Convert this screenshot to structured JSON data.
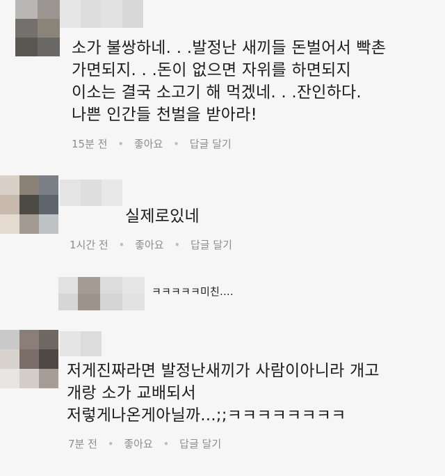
{
  "comments": [
    {
      "lines": [
        "소가 불쌍하네. . .발정난 새끼들 돈벌어서 빡촌",
        "가면되지. . .돈이 없으면 자위를 하면되지",
        "이소는 결국 소고기 해 먹겠네. . .잔인하다.",
        "나쁜 인간들 천벌을 받아라!"
      ],
      "time": "15분 전",
      "like_label": "좋아요",
      "reply_label": "답글 달기"
    },
    {
      "lines": [
        "실제로있네"
      ],
      "time": "1시간 전",
      "like_label": "좋아요",
      "reply_label": "답글 달기"
    },
    {
      "lines": [
        "ㅋㅋㅋㅋㅋ미친...."
      ]
    },
    {
      "lines": [
        "저게진짜라면 발정난새끼가 사람이아니라 개고",
        "개랑 소가 교배되서",
        "저렇게나온게아닐까...;;ㅋㅋㅋㅋㅋㅋㅋㅋ"
      ],
      "time": "7분 전",
      "like_label": "좋아요",
      "reply_label": "답글 달기"
    }
  ],
  "separator": "•",
  "colors": {
    "background": "#f6f6f6",
    "text": "#1c1c1c",
    "meta": "#8a8d91"
  }
}
